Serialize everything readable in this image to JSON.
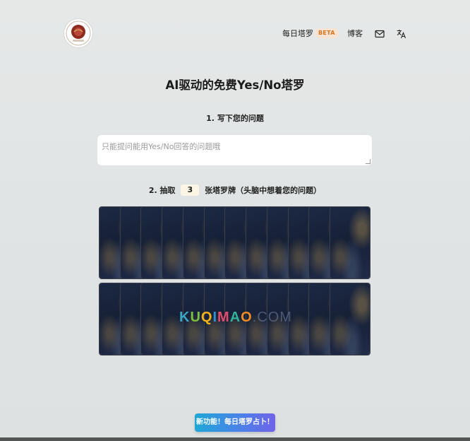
{
  "header": {
    "logo_text": "YES OR NO",
    "nav": {
      "daily_tarot": "每日塔罗",
      "beta_badge": "BETA",
      "blog": "博客",
      "mail_icon": "mail-icon",
      "translate_icon": "translate-icon"
    }
  },
  "main": {
    "title": "AI驱动的免费Yes/No塔罗",
    "step1_label": "1. 写下您的问题",
    "question_placeholder": "只能提问能用Yes/No回答的问题哦",
    "step2_prefix": "2. 抽取",
    "draw_count": "3",
    "step2_suffix": "张塔罗牌（头脑中想着您的问题）"
  },
  "deck": {
    "rows": 2,
    "cards_per_row": 12
  },
  "watermark": {
    "letters": [
      "K",
      "U",
      "Q",
      "I",
      "M",
      "A",
      "O"
    ],
    "colors": [
      "#3aa6c8",
      "#7cbf45",
      "#f0b21a",
      "#2f8fd6",
      "#e24b6b",
      "#2fb39a",
      "#f08a24"
    ],
    "rest": ".COM"
  },
  "promo_button": "新功能！每日塔罗占卜！",
  "colors": {
    "accent": "#4e7fe9",
    "badge_text": "#d9731f"
  }
}
